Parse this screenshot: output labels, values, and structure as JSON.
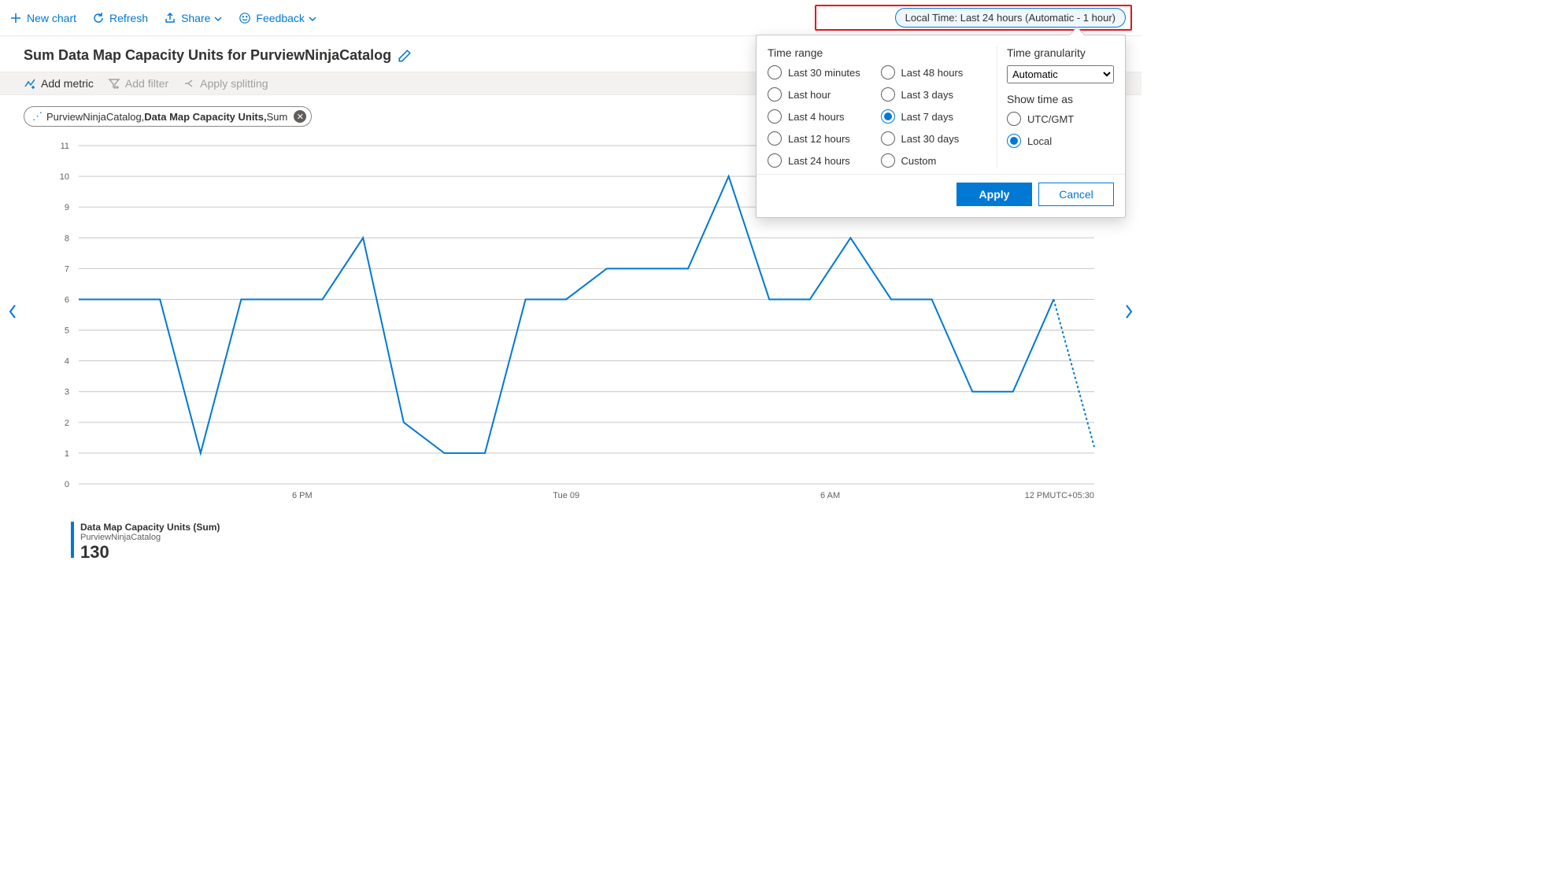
{
  "toolbar": {
    "new_chart": "New chart",
    "refresh": "Refresh",
    "share": "Share",
    "feedback": "Feedback",
    "time_pill": "Local Time: Last 24 hours (Automatic - 1 hour)"
  },
  "title": "Sum Data Map Capacity Units for PurviewNinjaCatalog",
  "metricbar": {
    "add_metric": "Add metric",
    "add_filter": "Add filter",
    "apply_splitting": "Apply splitting",
    "chart_type": "Line chart"
  },
  "pill": {
    "scope": "PurviewNinjaCatalog, ",
    "metric": "Data Map Capacity Units, ",
    "agg": "Sum"
  },
  "legend": {
    "title": "Data Map Capacity Units (Sum)",
    "subtitle": "PurviewNinjaCatalog",
    "value": "130"
  },
  "timezone_suffix": "UTC+05:30",
  "popover": {
    "time_range_label": "Time range",
    "ranges": [
      "Last 30 minutes",
      "Last 48 hours",
      "Last hour",
      "Last 3 days",
      "Last 4 hours",
      "Last 7 days",
      "Last 12 hours",
      "Last 30 days",
      "Last 24 hours",
      "Custom"
    ],
    "selected_range": "Last 7 days",
    "granularity_label": "Time granularity",
    "granularity_options": [
      "Automatic"
    ],
    "granularity_value": "Automatic",
    "show_time_as_label": "Show time as",
    "show_time_as": [
      "UTC/GMT",
      "Local"
    ],
    "show_time_as_selected": "Local",
    "apply": "Apply",
    "cancel": "Cancel"
  },
  "chart_data": {
    "type": "line",
    "title": "Sum Data Map Capacity Units for PurviewNinjaCatalog",
    "xlabel": "",
    "ylabel": "",
    "ylim": [
      0,
      11
    ],
    "y_ticks": [
      0,
      1,
      2,
      3,
      4,
      5,
      6,
      7,
      8,
      9,
      10,
      11
    ],
    "x_tick_labels": [
      "6 PM",
      "Tue 09",
      "6 AM",
      "12 PM"
    ],
    "x": [
      0,
      1,
      2,
      3,
      4,
      5,
      6,
      7,
      8,
      9,
      10,
      11,
      12,
      13,
      14,
      15,
      16,
      17,
      18,
      19,
      20,
      21,
      22,
      23,
      24
    ],
    "series": [
      {
        "name": "Data Map Capacity Units (Sum)",
        "scope": "PurviewNinjaCatalog",
        "total": 130,
        "values": [
          6,
          6,
          6,
          1,
          6,
          6,
          6,
          8,
          2,
          1,
          1,
          6,
          6,
          7,
          7,
          7,
          10,
          6,
          6,
          8,
          6,
          6,
          3,
          3,
          6
        ],
        "trailing_partial": {
          "x": 25,
          "value": 1.2
        }
      }
    ]
  }
}
